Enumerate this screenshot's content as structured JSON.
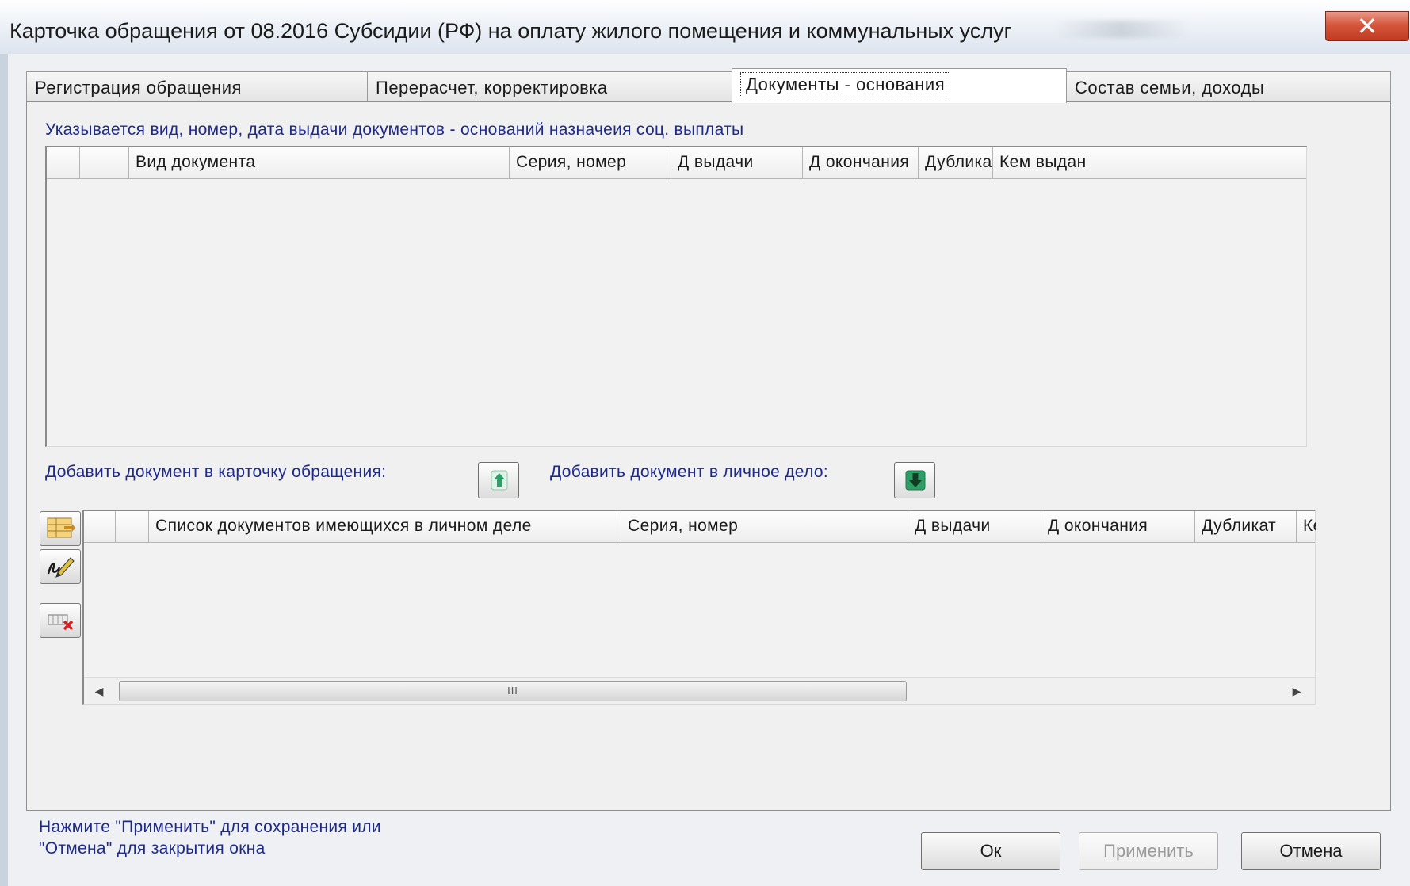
{
  "window": {
    "title": "Карточка обращения от 08.2016  Субсидии (РФ) на оплату жилого помещения и коммунальных услуг",
    "close_icon": "close-icon"
  },
  "tabs": [
    {
      "label": "Регистрация обращения",
      "active": false
    },
    {
      "label": "Перерасчет, корректировка",
      "active": false
    },
    {
      "label": "Документы - основания",
      "active": true
    },
    {
      "label": "Состав семьи, доходы",
      "active": false
    }
  ],
  "documents_section": {
    "hint": "Указывается вид, номер, дата выдачи документов - оснований назначеия соц. выплаты",
    "columns": [
      "",
      "",
      "Вид документа",
      "Серия, номер",
      "Д выдачи",
      "Д окончания",
      "Дубликат",
      "Кем выдан"
    ],
    "rows": []
  },
  "add_actions": {
    "to_card_label": "Добавить документ в карточку обращения:",
    "to_card_icon": "arrow-up-icon",
    "to_personal_label": "Добавить документ в личное дело:",
    "to_personal_icon": "arrow-down-icon"
  },
  "personal_section": {
    "side_buttons": [
      {
        "icon": "add-record-icon"
      },
      {
        "icon": "edit-record-icon"
      },
      {
        "icon": "delete-record-icon"
      }
    ],
    "columns": [
      "",
      "",
      "Список документов имеющихся в личном деле",
      "Серия, номер",
      "Д выдачи",
      "Д окончания",
      "Дубликат",
      "Кем выдан"
    ],
    "rows": [],
    "scroll_grip": "III"
  },
  "footer": {
    "hint_line1": "Нажмите \"Применить\" для сохранения или",
    "hint_line2": "\"Отмена\" для закрытия окна",
    "ok_label": "Ок",
    "apply_label": "Применить",
    "cancel_label": "Отмена"
  },
  "colors": {
    "hint_text": "#1e2a8a",
    "close_button": "#c94a30",
    "arrow_green": "#2f9e66"
  }
}
